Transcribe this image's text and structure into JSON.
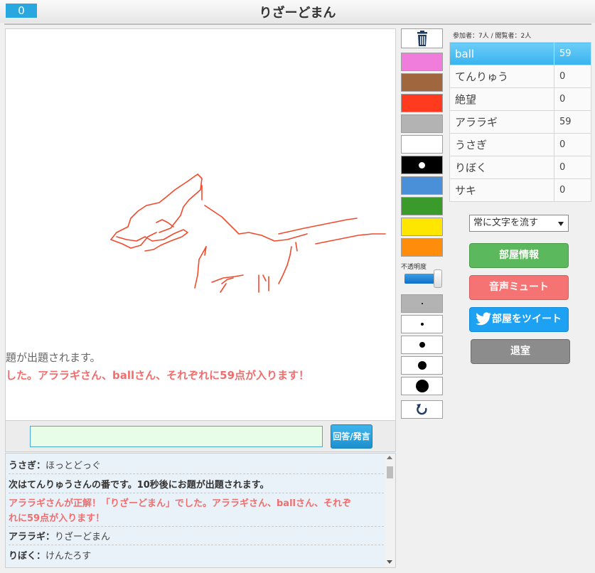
{
  "header": {
    "counter": "0",
    "title": "りざーどまん"
  },
  "canvas": {
    "overlay_line1": "題が出題されます。",
    "overlay_line2": "した。アララギさん、ballさん、それぞれに59点が入ります！",
    "stroke_color": "#f04a2c"
  },
  "answer": {
    "value": "",
    "button_label": "回答/発言"
  },
  "chat": {
    "messages": [
      {
        "name": "うさぎ：",
        "text": "ほっとどっぐ"
      },
      {
        "name": "",
        "text": "次はてんりゅうさんの番です。10秒後にお題が出題されます。"
      },
      {
        "name": "",
        "text": "アララギさんが正解！「りざーどまん」でした。アララギさん、ballさん、それぞ"
      },
      {
        "name": "",
        "text": "れに59点が入ります！"
      },
      {
        "name": "アララギ：",
        "text": "りざーどまん"
      },
      {
        "name": "りぼく：",
        "text": "けんたろす"
      }
    ]
  },
  "tools": {
    "trash_icon": "trash-icon",
    "colors": [
      "#f07ddb",
      "#a0663e",
      "#ff3a1f",
      "#b3b3b3",
      "#ffffff",
      "#000000",
      "#4a90d9",
      "#3a9a2a",
      "#ffe600",
      "#ff8c0a"
    ],
    "opacity_label": "不透明度",
    "opacity_level": 0.9,
    "undo_icon": "undo-icon"
  },
  "scoreboard": {
    "participants": "参加者：7人 / 閲覧者：2人",
    "players": [
      {
        "name": "ball",
        "score": "59"
      },
      {
        "name": "てんりゅう",
        "score": "0"
      },
      {
        "name": "絶望",
        "score": "0"
      },
      {
        "name": "アララギ",
        "score": "59"
      },
      {
        "name": "うさぎ",
        "score": "0"
      },
      {
        "name": "りぼく",
        "score": "0"
      },
      {
        "name": "サキ",
        "score": "0"
      }
    ]
  },
  "controls": {
    "mode_select": "常に文字を流す",
    "room_info": "部屋情報",
    "mute": "音声ミュート",
    "tweet": "部屋をツイート",
    "leave": "退室"
  }
}
